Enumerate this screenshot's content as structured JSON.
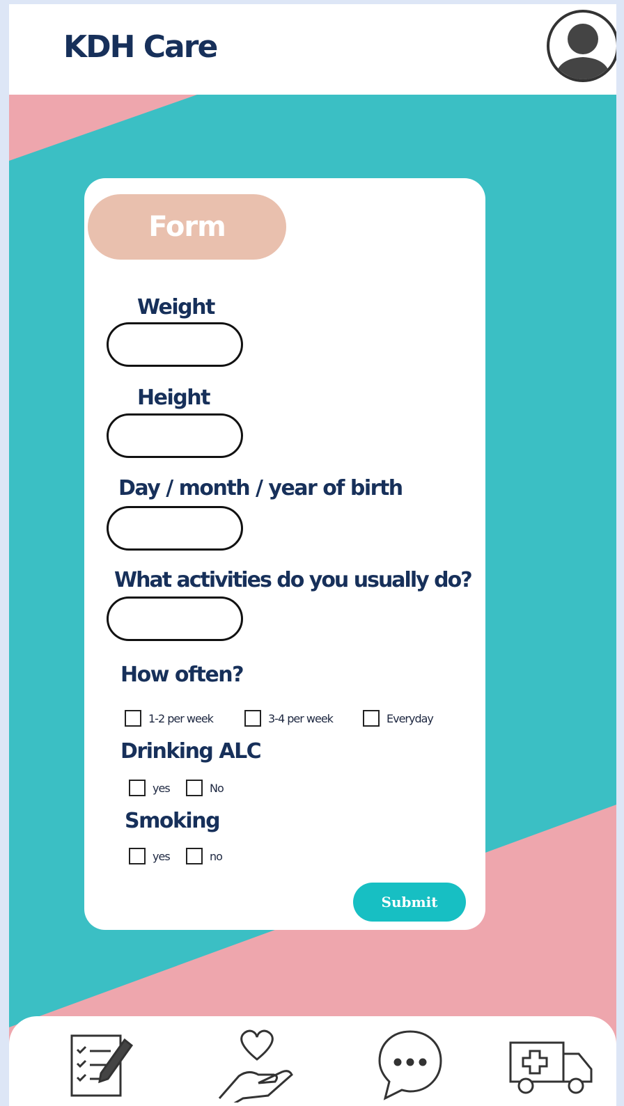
{
  "app": {
    "title": "KDH Care"
  },
  "header": {
    "profile_icon": "user-avatar-icon"
  },
  "form": {
    "tab_label": "Form",
    "weight": {
      "label": "Weight",
      "value": ""
    },
    "height": {
      "label": "Height",
      "value": ""
    },
    "birth": {
      "label": "Day / month / year of birth",
      "value": ""
    },
    "activities": {
      "label": "What activities do you usually do?",
      "value": ""
    },
    "frequency": {
      "label": "How often?",
      "options": [
        "1-2 per week",
        "3-4 per week",
        "Everyday"
      ]
    },
    "drinking": {
      "label": "Drinking ALC",
      "options": [
        "yes",
        "No"
      ]
    },
    "smoking": {
      "label": "Smoking",
      "options": [
        "yes",
        "no"
      ]
    },
    "submit_label": "Submit"
  },
  "nav": {
    "items": [
      {
        "icon": "clipboard-form-icon"
      },
      {
        "icon": "heart-hand-icon"
      },
      {
        "icon": "chat-bubble-icon"
      },
      {
        "icon": "ambulance-icon"
      }
    ]
  },
  "colors": {
    "teal": "#3bbfc4",
    "pink": "#eea6ad",
    "navy": "#17305a",
    "form_tab": "#e9c0ae",
    "submit": "#17bfc3"
  }
}
